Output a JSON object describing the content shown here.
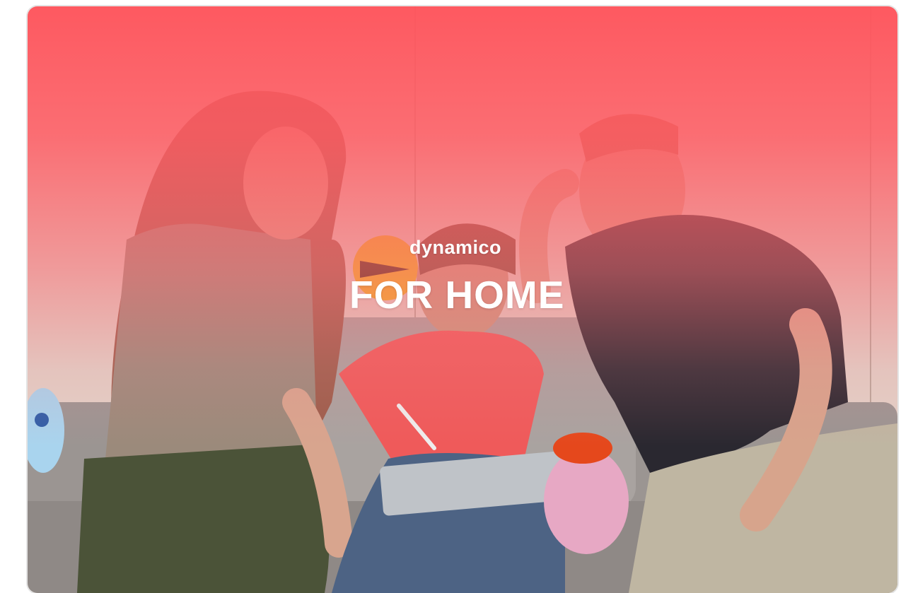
{
  "hero": {
    "brand": "dynamico",
    "headline": "FOR HOME"
  },
  "colors": {
    "overlay_accent": "#ff545c",
    "background": "#ffffff"
  }
}
